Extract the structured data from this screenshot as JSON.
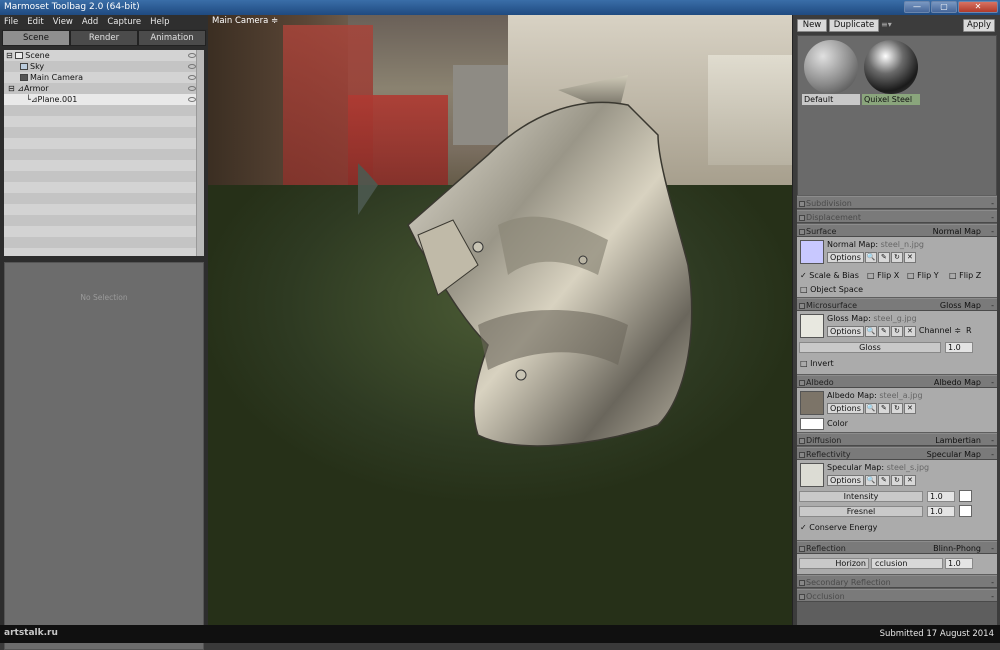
{
  "window": {
    "title": "Marmoset Toolbag 2.0 (64-bit)",
    "min": "—",
    "max": "▢",
    "close": "✕"
  },
  "menu": [
    "File",
    "Edit",
    "View",
    "Add",
    "Capture",
    "Help"
  ],
  "left_tabs": [
    "Scene",
    "Render",
    "Animation"
  ],
  "scene_tree": [
    {
      "label": "Scene",
      "indent": 0,
      "icon": "scene-icon"
    },
    {
      "label": "Sky",
      "indent": 1,
      "icon": "sky-icon"
    },
    {
      "label": "Main Camera",
      "indent": 1,
      "icon": "camera-icon"
    },
    {
      "label": "Armor",
      "indent": 1,
      "icon": "mesh-icon"
    },
    {
      "label": "Plane.001",
      "indent": 2,
      "icon": "submesh-icon"
    }
  ],
  "no_selection": "No Selection",
  "viewport": {
    "camera_label": "Main Camera ≑"
  },
  "material_toolbar": {
    "new": "New",
    "duplicate": "Duplicate",
    "menu": "≡▾",
    "apply": "Apply"
  },
  "materials": [
    {
      "name": "Default"
    },
    {
      "name": "Quixel Steel"
    }
  ],
  "sections": {
    "subdivision": "Subdivision",
    "displacement": "Displacement",
    "surface": {
      "label": "Surface",
      "type": "Normal Map"
    },
    "microsurface": {
      "label": "Microsurface",
      "type": "Gloss Map"
    },
    "albedo": {
      "label": "Albedo",
      "type": "Albedo Map"
    },
    "diffusion": {
      "label": "Diffusion",
      "type": "Lambertian"
    },
    "reflectivity": {
      "label": "Reflectivity",
      "type": "Specular Map"
    },
    "reflection": {
      "label": "Reflection",
      "type": "Blinn-Phong"
    },
    "secondary": "Secondary Reflection",
    "occlusion": "Occlusion"
  },
  "normal": {
    "label": "Normal Map:",
    "file": "steel_n.jpg",
    "options": "Options",
    "scale_bias": "Scale & Bias",
    "flip_x": "Flip X",
    "flip_y": "Flip Y",
    "flip_z": "Flip Z",
    "object_space": "Object Space"
  },
  "gloss": {
    "label": "Gloss Map:",
    "file": "steel_g.jpg",
    "options": "Options",
    "channel": "Channel ≑",
    "channel_val": "R",
    "slider": "Gloss",
    "value": "1.0",
    "invert": "Invert"
  },
  "albedo": {
    "label": "Albedo Map:",
    "file": "steel_a.jpg",
    "options": "Options",
    "color": "Color"
  },
  "specular": {
    "label": "Specular Map:",
    "file": "steel_s.jpg",
    "options": "Options",
    "intensity": "Intensity",
    "intensity_val": "1.0",
    "fresnel": "Fresnel",
    "fresnel_val": "1.0",
    "conserve": "Conserve Energy"
  },
  "reflection": {
    "horizon": "Horizon",
    "occlusion": "cclusion",
    "value": "1.0"
  },
  "footer": {
    "logo": "artstalk.ru",
    "submitted": "Submitted 17 August 2014"
  },
  "icons": {
    "search": "🔍",
    "edit": "✎",
    "refresh": "↻",
    "clear": "✕"
  }
}
